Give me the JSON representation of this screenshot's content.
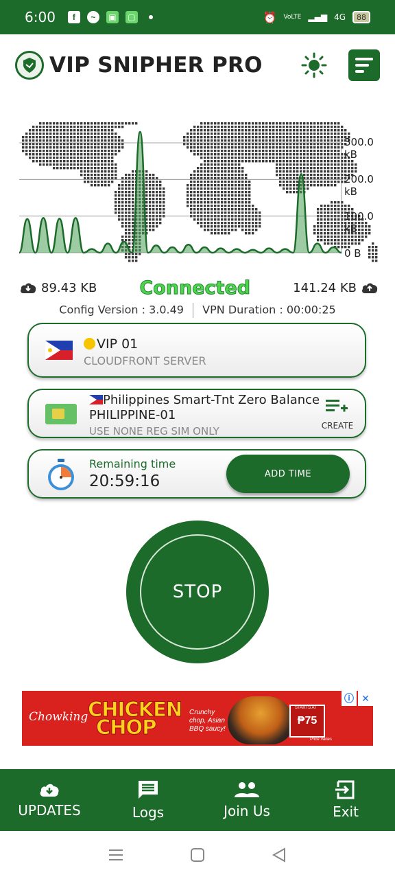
{
  "status_bar": {
    "time": "6:00",
    "battery": "88",
    "network": "4G",
    "volte": "VoLTE"
  },
  "header": {
    "title": "VIP SNIPHER PRO"
  },
  "graph": {
    "y_labels": [
      "300.0 kB",
      "200.0 kB",
      "100.0 kB",
      "0 B"
    ]
  },
  "chart_data": {
    "type": "area",
    "ylabel": "",
    "xlabel": "",
    "y_ticks": [
      "0 B",
      "100.0 kB",
      "200.0 kB",
      "300.0 kB"
    ],
    "ylim": [
      0,
      300
    ],
    "series": [
      {
        "values": [
          0,
          92,
          0,
          95,
          0,
          93,
          0,
          95,
          0,
          10,
          0,
          25,
          0,
          30,
          0,
          330,
          0,
          20,
          0,
          15,
          0,
          22,
          0,
          15,
          0,
          12,
          0,
          10,
          0,
          8,
          0,
          12,
          0,
          10,
          0,
          215,
          0,
          25,
          0,
          15,
          0
        ]
      }
    ]
  },
  "traffic": {
    "download": "89.43 KB",
    "status": "Connected",
    "upload": "141.24 KB"
  },
  "info": {
    "config_version": "Config Version : 3.0.49",
    "vpn_duration": "VPN Duration : 00:00:25"
  },
  "server_card": {
    "name": "VIP 01",
    "subtitle": "CLOUDFRONT SERVER"
  },
  "network_card": {
    "line1": "Philippines Smart-Tnt Zero Balance",
    "line2": "PHILIPPINE-01",
    "line3": "USE NONE REG SIM ONLY",
    "create_label": "CREATE"
  },
  "time_card": {
    "label": "Remaining time",
    "value": "20:59:16",
    "add_time_label": "ADD TIME"
  },
  "main_button": {
    "label": "STOP"
  },
  "ad": {
    "brand": "Chowking",
    "title_line1": "CHICKEN",
    "title_line2": "CHOP",
    "tagline": "Crunchy chop, Asian BBQ saucy!",
    "starts_at": "STARTS AT",
    "price": "₱75",
    "price_note": "Price Varies"
  },
  "bottom_nav": [
    {
      "label": "UPDATES"
    },
    {
      "label": "Logs"
    },
    {
      "label": "Join Us"
    },
    {
      "label": "Exit"
    }
  ],
  "colors": {
    "primary": "#1d6b2b",
    "connected": "#4fd24f",
    "map_dots": "#3a3a3a"
  }
}
